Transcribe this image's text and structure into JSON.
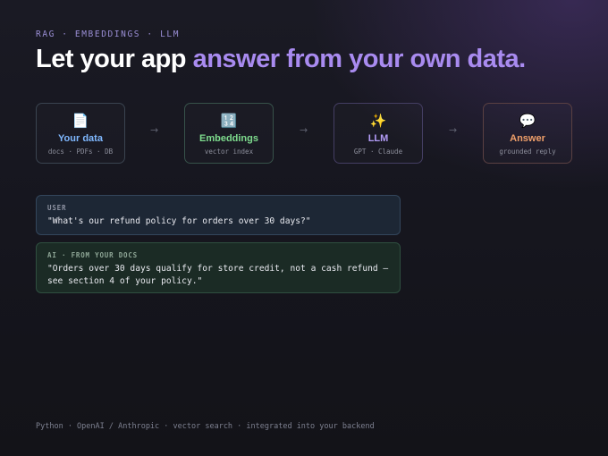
{
  "eyebrow": "RAG · EMBEDDINGS · LLM",
  "headline": {
    "lead": "Let your app",
    "accent": "answer from your own data."
  },
  "pipeline": {
    "steps": [
      {
        "icon": "📄",
        "icon_name": "document-icon",
        "title": "Your data",
        "subtitle": "docs · PDFs · DB",
        "color": "#7fb8ff"
      },
      {
        "icon": "🔢",
        "icon_name": "numbers-icon",
        "title": "Embeddings",
        "subtitle": "vector index",
        "color": "#7edc8e"
      },
      {
        "icon": "✨",
        "icon_name": "sparkles-icon",
        "title": "LLM",
        "subtitle": "GPT · Claude",
        "color": "#b39cf7"
      },
      {
        "icon": "💬",
        "icon_name": "speech-bubble-icon",
        "title": "Answer",
        "subtitle": "grounded reply",
        "color": "#f0a06a"
      }
    ],
    "arrow": "→"
  },
  "chat": {
    "user": {
      "label": "USER",
      "message": "\"What's our refund policy for orders over 30 days?\""
    },
    "ai": {
      "label": "AI · FROM YOUR DOCS",
      "message": "\"Orders over 30 days qualify for store credit, not a cash refund — see section 4 of your policy.\""
    }
  },
  "footer": "Python · OpenAI / Anthropic · vector search · integrated into your backend",
  "colors": {
    "accent": "#a98bf0",
    "eyebrow": "#9b8fd6",
    "background": "#15151d"
  }
}
